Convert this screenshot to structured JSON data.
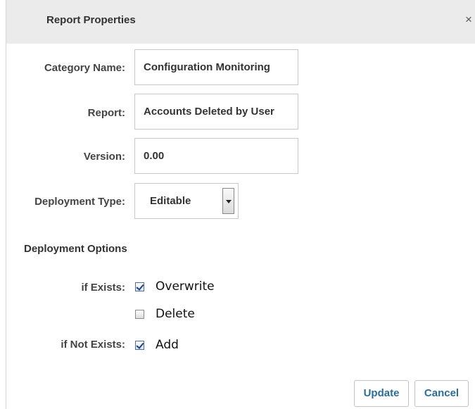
{
  "dialog": {
    "title": "Report Properties"
  },
  "form": {
    "category_label": "Category Name:",
    "category_value": "Configuration Monitoring",
    "report_label": "Report:",
    "report_value": "Accounts Deleted by User",
    "version_label": "Version:",
    "version_value": "0.00",
    "deployment_type_label": "Deployment Type:",
    "deployment_type_value": "Editable"
  },
  "deployment_options": {
    "title": "Deployment Options",
    "if_exists_label": "if Exists:",
    "if_not_exists_label": "if Not Exists:",
    "options": [
      {
        "label": "Overwrite",
        "checked": true
      },
      {
        "label": "Delete",
        "checked": false
      },
      {
        "label": "Add",
        "checked": true
      }
    ]
  },
  "buttons": {
    "update": "Update",
    "cancel": "Cancel"
  },
  "colors": {
    "header_bg": "#ebebeb",
    "button_text": "#2a6ba4",
    "border": "#c8c8c8"
  }
}
